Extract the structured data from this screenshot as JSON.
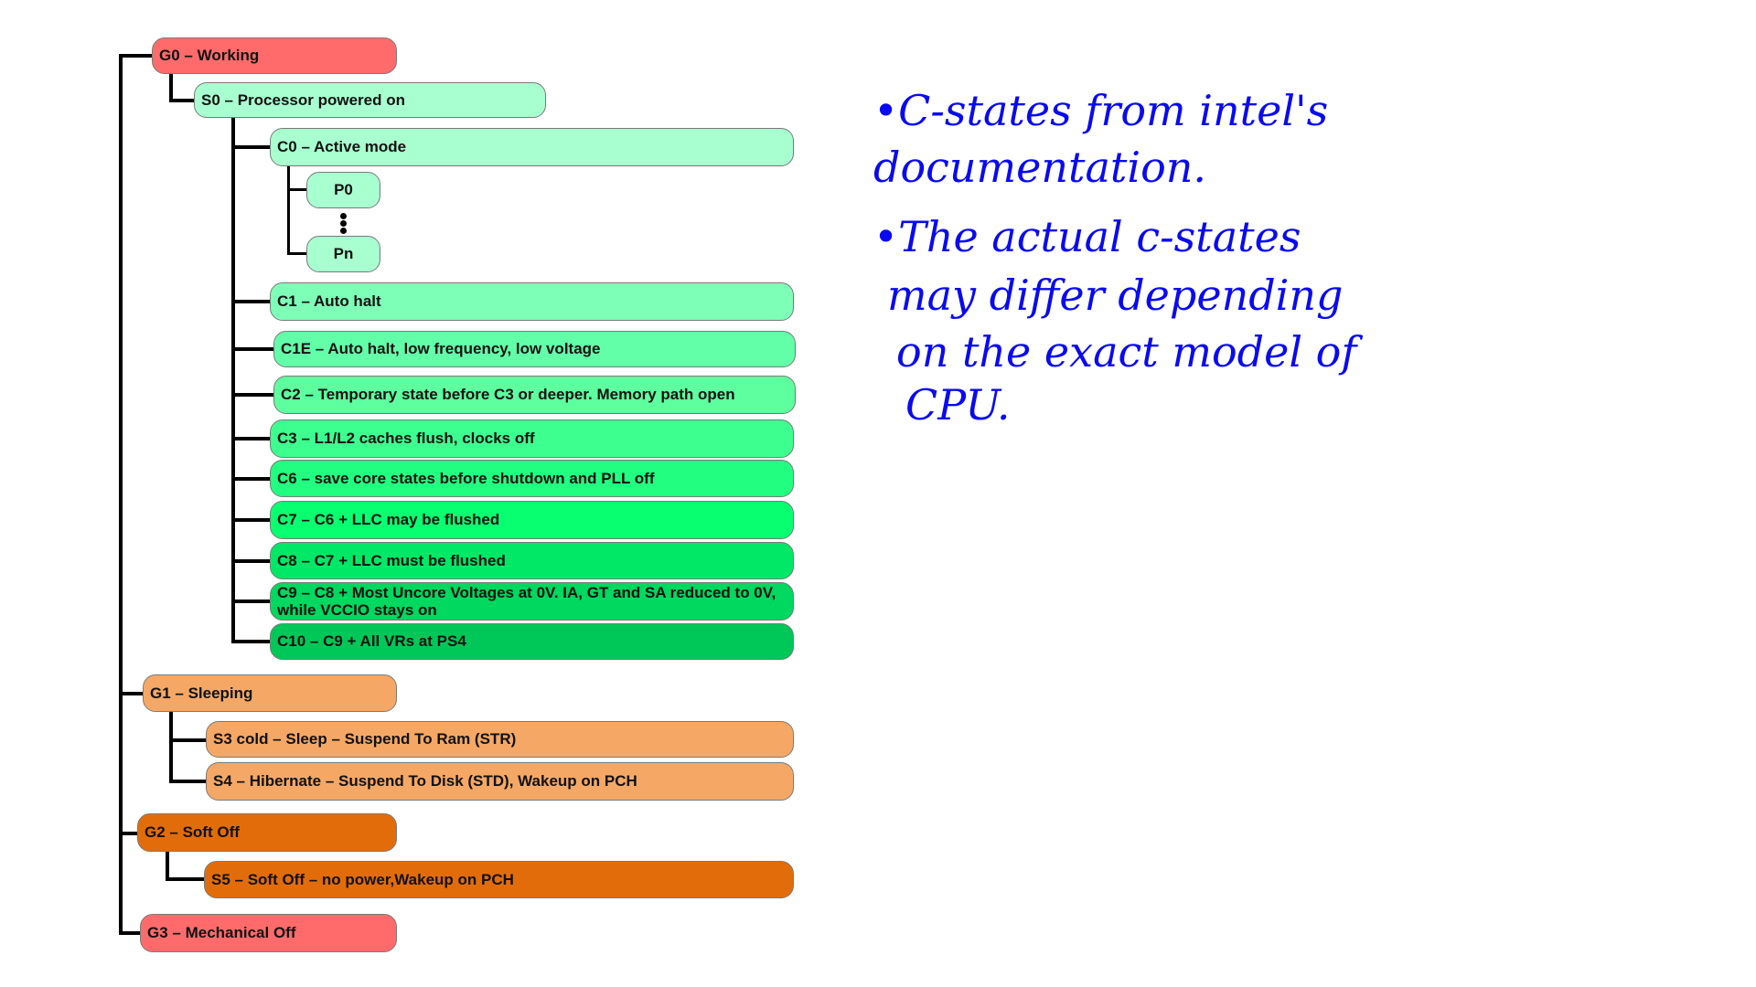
{
  "tree": {
    "g0": {
      "label": "G0 – Working",
      "color": "#ff6b6b"
    },
    "s0": {
      "label": "S0 – Processor powered on",
      "color": "#a8ffd0"
    },
    "c0": {
      "label": "C0 – Active mode",
      "color": "#a8ffd0"
    },
    "p0": {
      "label": "P0",
      "color": "#a8ffd0"
    },
    "pn": {
      "label": "Pn",
      "color": "#a8ffd0"
    },
    "c1": {
      "label": "C1 – Auto halt",
      "color": "#7dffb8"
    },
    "c1e": {
      "label": "C1E – Auto halt, low frequency, low voltage",
      "color": "#62ffa8"
    },
    "c2": {
      "label": "C2 – Temporary state before C3 or deeper. Memory path open",
      "color": "#5dff9e"
    },
    "c3": {
      "label": "C3 – L1/L2 caches flush, clocks off",
      "color": "#3dff90"
    },
    "c6": {
      "label": "C6 – save core states before shutdown and PLL off",
      "color": "#22ff80"
    },
    "c7": {
      "label": "C7 – C6 + LLC may be flushed",
      "color": "#08ff70"
    },
    "c8": {
      "label": "C8 – C7 + LLC must be flushed",
      "color": "#00e866"
    },
    "c9": {
      "label": "C9 – C8 + Most Uncore Voltages at 0V. IA, GT and SA reduced to 0V, while VCCIO stays on",
      "color": "#00d85f"
    },
    "c10": {
      "label": "C10 – C9 + All VRs at PS4",
      "color": "#00c858"
    },
    "g1": {
      "label": "G1 – Sleeping",
      "color": "#f5a865"
    },
    "s3": {
      "label": "S3 cold – Sleep – Suspend To Ram (STR)",
      "color": "#f5a865"
    },
    "s4": {
      "label": "S4 – Hibernate – Suspend To Disk (STD), Wakeup on PCH",
      "color": "#f5a865"
    },
    "g2": {
      "label": "G2 – Soft Off",
      "color": "#e36c0a"
    },
    "s5": {
      "label": "S5 – Soft Off – no power,Wakeup on PCH",
      "color": "#e36c0a"
    },
    "g3": {
      "label": "G3 – Mechanical Off",
      "color": "#ff6b6b"
    }
  },
  "notes": {
    "line1": "•C-states from intel's",
    "line2": "documentation.",
    "line3": "•The actual c-states",
    "line4": "may differ depending",
    "line5": "on the exact model of",
    "line6": "CPU.",
    "ink_color": "#0a0af0"
  }
}
